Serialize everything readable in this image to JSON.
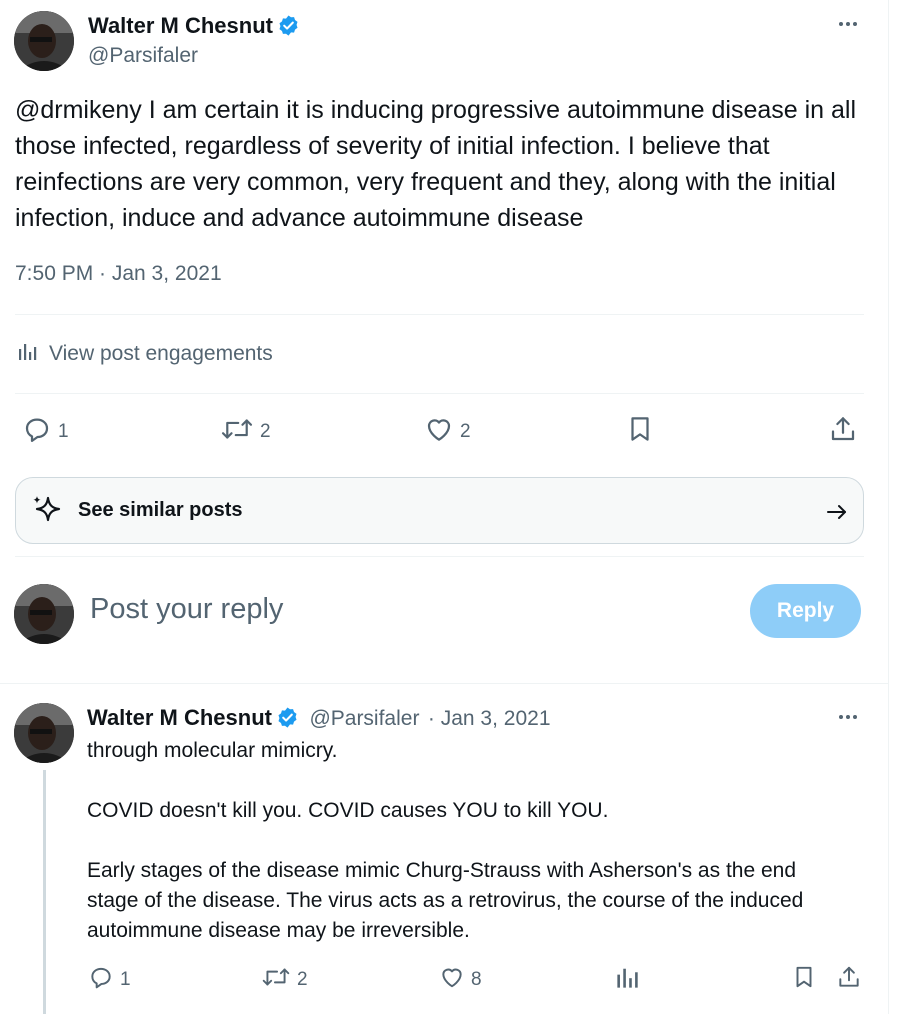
{
  "post": {
    "author_name": "Walter M Chesnut",
    "author_handle": "@Parsifaler",
    "text": "@drmikeny I am certain it is inducing progressive autoimmune disease in all those infected, regardless of severity of initial infection. I believe that reinfections are very common, very frequent and they, along with the initial infection, induce and advance autoimmune disease",
    "timestamp": "7:50 PM · Jan 3, 2021",
    "engagements_label": "View post engagements",
    "replies": "1",
    "reposts": "2",
    "likes": "2"
  },
  "similar": {
    "label": "See similar posts"
  },
  "composer": {
    "placeholder": "Post your reply",
    "button_label": "Reply"
  },
  "reply": {
    "author_name": "Walter M Chesnut",
    "author_handle": "@Parsifaler",
    "date": "· Jan 3, 2021",
    "line1": "through molecular mimicry.",
    "line2": "COVID doesn't kill you. COVID causes YOU to kill YOU.",
    "line3": "Early stages of the disease mimic Churg-Strauss with Asherson's as the end stage of the disease. The virus acts as a retrovirus, the course of the induced autoimmune disease may be irreversible.",
    "replies": "1",
    "reposts": "2",
    "likes": "8"
  },
  "colors": {
    "accent": "#1d9bf0",
    "muted": "#536471",
    "reply_button": "#8ecdf8",
    "border": "#eff3f4"
  },
  "icons": [
    "verified-badge-icon",
    "more-icon",
    "analytics-icon",
    "reply-icon",
    "repost-icon",
    "like-icon",
    "bookmark-icon",
    "share-icon",
    "sparkle-icon",
    "arrow-right-icon",
    "views-icon"
  ]
}
